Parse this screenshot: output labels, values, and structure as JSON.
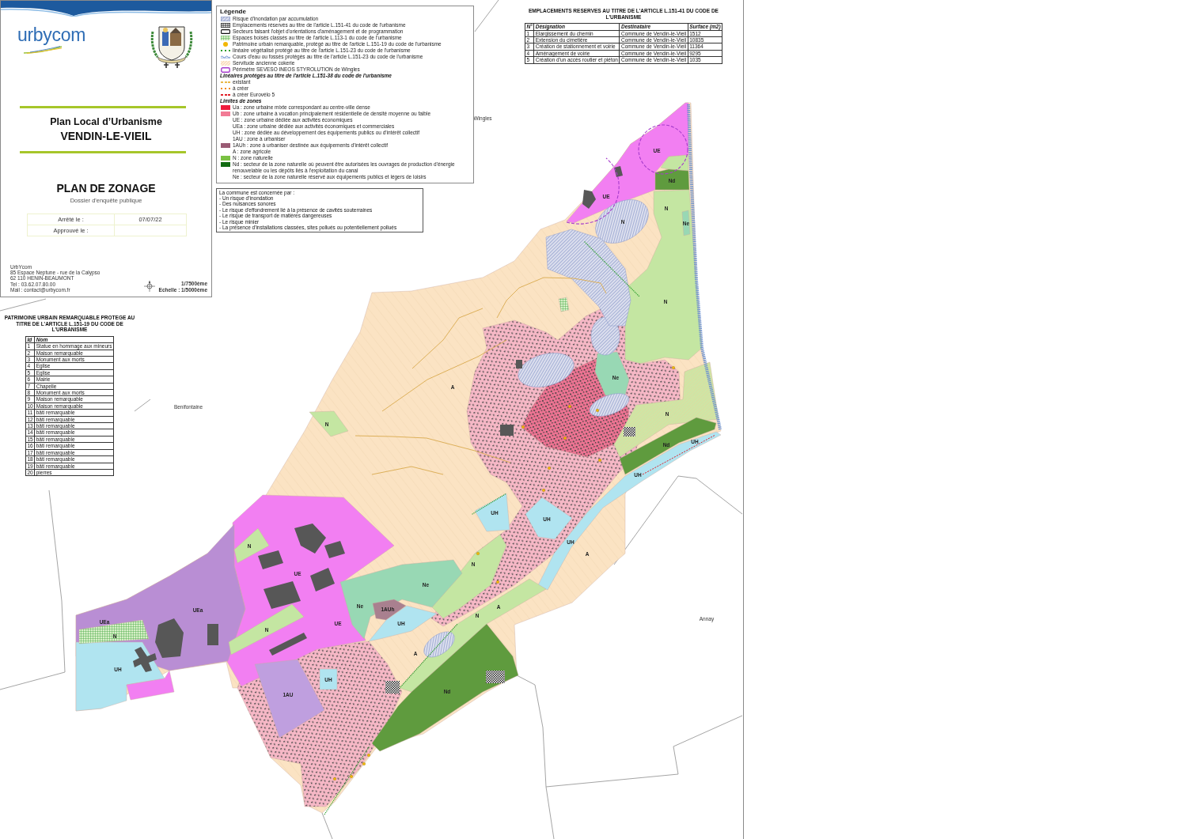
{
  "title_block": {
    "logo": "urbycom",
    "plan_title": "Plan Local d’Urbanisme",
    "commune": "VENDIN-LE-VIEIL",
    "document_title": "PLAN DE ZONAGE",
    "document_subtitle": "Dossier d'enquête publique",
    "dates": [
      {
        "label": "Arrêté le :",
        "value": "07/07/22"
      },
      {
        "label": "Approuvé le :"
      }
    ],
    "address": [
      "UrbYcom",
      "85 Espace Neptune - rue de la Calypso",
      "62 110 HENIN-BEAUMONT",
      "Tel : 03.62.07.80.00",
      "Mail : contact@urbycom.fr"
    ],
    "scale": [
      "1/7500ème",
      "Echelle : 1/5000ème"
    ]
  },
  "legend": {
    "title": "Légende",
    "items": [
      {
        "kind": "flood",
        "label": "Risque d'inondation par accumulation"
      },
      {
        "kind": "reserved",
        "label": "Emplacements réservés au titre de l'article L.151-41 du code de l'urbanisme"
      },
      {
        "kind": "oap",
        "label": "Secteurs faisant l'objet d'orientations d'aménagement et de programmation"
      },
      {
        "kind": "woodland",
        "label": "Espaces boisés classés au titre de l'article L.113-1 du code de l'urbanisme"
      },
      {
        "kind": "dot",
        "color": "#f2b705",
        "label": "Patrimoine urbain remarquable, protégé au titre de l'article L.151-19 du code de l'urbanisme"
      },
      {
        "kind": "dotted-line",
        "color": "#2e9e2e",
        "label": "linéaire végétalisé protégé au titre de l'article L.151-23 du code de l'urbanisme"
      },
      {
        "kind": "water",
        "label": "Cours d'eau ou fossés protégés au titre de l'article L.151-23 du code de l'urbanisme"
      },
      {
        "kind": "cokerie",
        "label": "Servitude ancienne cokerie"
      },
      {
        "kind": "seveso",
        "label": "Périmètre SEVESO INEOS STYROLUTION de Wingles"
      },
      {
        "kind": "heading",
        "label": "Linéaires protégés au titre de l'article L.151-38 du code de l'urbanisme"
      },
      {
        "kind": "dashed-line",
        "color": "#e9b949",
        "label": "existant"
      },
      {
        "kind": "dotted-line",
        "color": "#f08a1c",
        "label": "à créer"
      },
      {
        "kind": "dashed-line",
        "color": "#e0202a",
        "label": "à créer Eurovélo 5"
      },
      {
        "kind": "heading",
        "label": "Limites de zones"
      },
      {
        "kind": "fill",
        "color": "#ee1c3c",
        "label": "Ua : zone urbaine mixte correspondant au centre-ville dense"
      },
      {
        "kind": "fill",
        "color": "#f27b95",
        "label": "Ub : zone urbaine à vocation principalement résidentielle de densité moyenne ou faible"
      },
      {
        "kind": "blank",
        "label": "UE : zone urbaine dédiée aux activités économiques"
      },
      {
        "kind": "blank",
        "label": "UEa : zone urbaine dédiée aux activités économiques et commerciales"
      },
      {
        "kind": "blank",
        "label": "UH : zone dédiée au développement des équipements publics ou d'intérêt collectif"
      },
      {
        "kind": "blank",
        "label": "1AU : zone à urbaniser"
      },
      {
        "kind": "fill",
        "color": "#9a5b74",
        "label": "1AUh : zone à urbaniser destinée aux équipements d'intérêt collectif"
      },
      {
        "kind": "blank",
        "label": "A : zone agricole"
      },
      {
        "kind": "fill",
        "color": "#7ac143",
        "label": "N : zone naturelle"
      },
      {
        "kind": "fill",
        "color": "#116b12",
        "label": "Nd : secteur de la zone naturelle où peuvent être autorisées les ouvrages de production d'énergie renouvelable ou les dépôts liés à l'exploitation du canal"
      },
      {
        "kind": "blank",
        "label": "Ne : secteur de la zone naturelle réservé aux équipements publics et légers de loisirs"
      }
    ]
  },
  "notice": {
    "intro": "La commune est concernée par :",
    "items": [
      "- Un risque d'inondation",
      "- Des nuisances sonores",
      "- Le risque d'effondrement lié à la présence de cavités souterraines",
      "- Le risque de transport de matières dangereuses",
      "- Le risque minier",
      "- La présence d'installations classées, sites pollués ou potentiellement pollués"
    ]
  },
  "reserved_sites": {
    "title": "EMPLACEMENTS RESERVES AU TITRE DE L'ARTICLE L.151-41 DU CODE DE L'URBANISME",
    "columns": [
      "N°",
      "Désignation",
      "Destinataire",
      "Surface (m2)"
    ],
    "rows": [
      [
        "1",
        "Elargissement du chemin",
        "Commune de Vendin-le-Vieil",
        "1512"
      ],
      [
        "2",
        "Extension du cimetière",
        "Commune de Vendin-le-Vieil",
        "10835"
      ],
      [
        "3",
        "Création de stationnement et voirie",
        "Commune de Vendin-le-Vieil",
        "11364"
      ],
      [
        "4",
        "Aménagement de voirie",
        "Commune de Vendin-le-Vieil",
        "9295"
      ],
      [
        "5",
        "Création d'un accès routier et piéton",
        "Commune de Vendin-le-Vieil",
        "1035"
      ]
    ]
  },
  "heritage": {
    "title": "PATRIMOINE URBAIN REMARQUABLE PROTEGE AU TITRE DE L'ARTICLE L.151-19 DU CODE DE L'URBANISME",
    "columns": [
      "Id",
      "Nom"
    ],
    "rows": [
      [
        "1",
        "Statue en hommage aux mineurs"
      ],
      [
        "2",
        "Maison remarquable"
      ],
      [
        "3",
        "Monument aux morts"
      ],
      [
        "4",
        "Eglise"
      ],
      [
        "5",
        "Eglise"
      ],
      [
        "6",
        "Mairie"
      ],
      [
        "7",
        "Chapelle"
      ],
      [
        "8",
        "Monument aux morts"
      ],
      [
        "9",
        "Maison remarquable"
      ],
      [
        "10",
        "Maison remarquable"
      ],
      [
        "11",
        "bâti remarquable"
      ],
      [
        "12",
        "bâti remarquable"
      ],
      [
        "13",
        "bâti remarquable"
      ],
      [
        "14",
        "bâti remarquable"
      ],
      [
        "15",
        "bâti remarquable"
      ],
      [
        "16",
        "bâti remarquable"
      ],
      [
        "17",
        "bâti remarquable"
      ],
      [
        "18",
        "bâti remarquable"
      ],
      [
        "19",
        "bâti remarquable"
      ],
      [
        "20",
        "pierres"
      ]
    ]
  },
  "map": {
    "places": [
      "Wingles",
      "Benifontaine",
      "Annay"
    ],
    "zone_labels": [
      "UE",
      "Nd",
      "UE",
      "N",
      "N",
      "Ne",
      "N",
      "Ne",
      "A",
      "N",
      "N",
      "UH",
      "Nd",
      "UH",
      "UH",
      "UH",
      "UH",
      "N",
      "A",
      "N",
      "UE",
      "Ne",
      "Ne",
      "1AUh",
      "A",
      "UEa",
      "N",
      "UE",
      "UEa",
      "UH",
      "N",
      "N",
      "A",
      "UH",
      "UH",
      "Nd",
      "1AU"
    ]
  }
}
